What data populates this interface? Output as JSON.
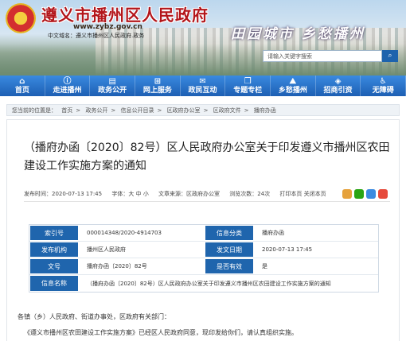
{
  "header": {
    "site_title": "遵义市播州区人民政府",
    "site_url": "www.zybz.gov.cn",
    "site_sub": "中文域名：遵义市播州区人民政府.政务",
    "slogan": "田园城市 乡愁播州",
    "search_placeholder": "请输入关键字搜索",
    "search_icon": "search-icon"
  },
  "nav": [
    {
      "label": "首页",
      "icon": "home-icon"
    },
    {
      "label": "走进播州",
      "icon": "info-icon"
    },
    {
      "label": "政务公开",
      "icon": "doc-icon"
    },
    {
      "label": "网上服务",
      "icon": "service-icon"
    },
    {
      "label": "政民互动",
      "icon": "chat-icon"
    },
    {
      "label": "专题专栏",
      "icon": "column-icon"
    },
    {
      "label": "乡愁播州",
      "icon": "landscape-icon"
    },
    {
      "label": "招商引资",
      "icon": "invest-icon"
    },
    {
      "label": "无障碍",
      "icon": "access-icon"
    }
  ],
  "breadcrumb": {
    "prefix": "您当前的位置是：",
    "items": [
      "首页",
      "政务公开",
      "信息公开目录",
      "区政府办公室",
      "区政府文件",
      "播府办函"
    ]
  },
  "article": {
    "title": "（播府办函〔2020〕82号）区人民政府办公室关于印发遵义市播州区农田建设工作实施方案的通知",
    "date_label": "发布时间：2020-07-13 17:45",
    "font_label": "字体：大 中 小",
    "source_label": "文章来源：区政府办公室",
    "views_label": "浏览次数：24次",
    "actions_label": "打印本页 关闭本页",
    "intro": "各镇（乡）人民政府、街道办事处，区政府有关部门：",
    "paragraph": "《遵义市播州区农田建设工作实施方案》已经区人民政府同意，现印发给你们，请认真组织实施。"
  },
  "info_table": {
    "rows": [
      [
        {
          "label": "索引号",
          "value": "000014348/2020-4914703"
        },
        {
          "label": "信息分类",
          "value": "播府办函"
        }
      ],
      [
        {
          "label": "发布机构",
          "value": "播州区人民政府"
        },
        {
          "label": "发文日期",
          "value": "2020-07-13 17:45"
        }
      ],
      [
        {
          "label": "文号",
          "value": "播府办函〔2020〕82号"
        },
        {
          "label": "是否有效",
          "value": "是"
        }
      ],
      [
        {
          "label": "信息名称",
          "value": "（播府办函〔2020〕82号）区人民政府办公室关于印发遵义市播州区农田建设工作实施方案的通知"
        }
      ]
    ]
  },
  "colors": {
    "brand_red": "#b3161b",
    "nav_blue": "#1d5fb3",
    "label_blue": "#1f65ad"
  }
}
